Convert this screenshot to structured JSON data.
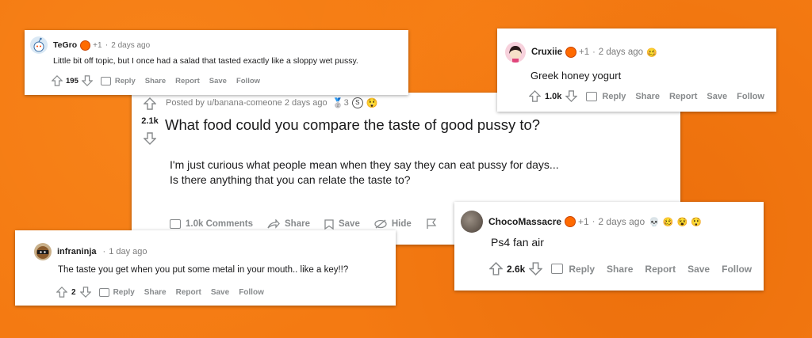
{
  "colors": {
    "background": "#f47a12",
    "muted": "#878a8c",
    "text": "#1a1a1b"
  },
  "post": {
    "posted_by": "Posted by u/banana-comeone 2 days ago",
    "award_count": "3",
    "score": "2.1k",
    "title": "What food could you compare the taste of good pussy to?",
    "body_line1": "I'm just curious what people mean when they say they can eat pussy for days...",
    "body_line2": "Is there anything that you can relate the taste to?",
    "comments": "1.0k Comments",
    "share": "Share",
    "save": "Save",
    "hide": "Hide"
  },
  "comments": [
    {
      "user": "TeGro",
      "plus": "+1",
      "time": "2 days ago",
      "text": "Little bit off topic, but I once had a salad that tasted exactly like a sloppy wet pussy.",
      "score": "195",
      "actions": [
        "Reply",
        "Share",
        "Report",
        "Save",
        "Follow"
      ],
      "avatar_icon": "snoo-avatar-icon"
    },
    {
      "user": "Cruxiie",
      "plus": "+1",
      "time": "2 days ago",
      "text": "Greek honey yogurt",
      "score": "1.0k",
      "actions": [
        "Reply",
        "Share",
        "Report",
        "Save",
        "Follow"
      ],
      "avatar_icon": "girl-avatar-icon"
    },
    {
      "user": "infraninja",
      "plus": "",
      "time": "1 day ago",
      "text": "The taste you get when you put some metal in your mouth.. like a key!!?",
      "score": "2",
      "actions": [
        "Reply",
        "Share",
        "Report",
        "Save",
        "Follow"
      ],
      "avatar_icon": "ninja-avatar-icon"
    },
    {
      "user": "ChocoMassacre",
      "plus": "+1",
      "time": "2 days ago",
      "text": "Ps4 fan air",
      "score": "2.6k",
      "actions": [
        "Reply",
        "Share",
        "Report",
        "Save",
        "Follow"
      ],
      "avatar_icon": "photo-avatar-icon"
    }
  ]
}
